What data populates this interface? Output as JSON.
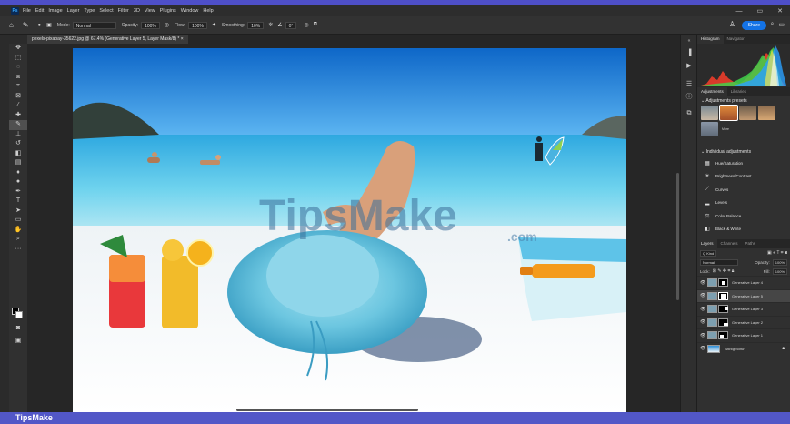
{
  "menubar": {
    "logo": "Ps",
    "items": [
      "File",
      "Edit",
      "Image",
      "Layer",
      "Type",
      "Select",
      "Filter",
      "3D",
      "View",
      "Plugins",
      "Window",
      "Help"
    ],
    "controls": [
      "—",
      "▭",
      "✕"
    ]
  },
  "options": {
    "mode_label": "Mode:",
    "mode_value": "Normal",
    "opacity_label": "Opacity:",
    "opacity_value": "100%",
    "flow_label": "Flow:",
    "flow_value": "100%",
    "smoothing_label": "Smoothing:",
    "smoothing_value": "10%",
    "angle_value": "0°",
    "share_label": "Share"
  },
  "document": {
    "tab_title": "pexels-pixabay-35622.jpg @ 67.4% (Generative Layer 5, Layer Mask/8) *  ×"
  },
  "watermark": {
    "main": "TipsMake",
    "suffix": ".com"
  },
  "panels": {
    "top_tabs": [
      "Histogram",
      "Navigator"
    ],
    "adj_tabs": [
      "Adjustments",
      "Libraries"
    ],
    "presets_title": "Adjustments presets",
    "presets_more": "More",
    "individual_title": "Individual adjustments",
    "adjustments": [
      {
        "icon": "hue-saturation-icon",
        "label": "Hue/Saturation"
      },
      {
        "icon": "brightness-contrast-icon",
        "label": "Brightness/Contrast"
      },
      {
        "icon": "curves-icon",
        "label": "Curves"
      },
      {
        "icon": "levels-icon",
        "label": "Levels"
      },
      {
        "icon": "color-balance-icon",
        "label": "Color Balance"
      },
      {
        "icon": "black-white-icon",
        "label": "Black & White"
      }
    ],
    "layer_tabs": [
      "Layers",
      "Channels",
      "Paths"
    ],
    "kind_label": "Q Kind",
    "blend_mode": "Normal",
    "opacity_label": "Opacity:",
    "opacity_value": "100%",
    "lock_label": "Lock:",
    "fill_label": "Fill:",
    "fill_value": "100%",
    "layers": [
      {
        "name": "Generative Layer 4",
        "selected": false
      },
      {
        "name": "Generative Layer 5",
        "selected": true
      },
      {
        "name": "Generative Layer 3",
        "selected": false
      },
      {
        "name": "Generative Layer 2",
        "selected": false
      },
      {
        "name": "Generative Layer 1",
        "selected": false
      },
      {
        "name": "Background",
        "selected": false
      }
    ]
  },
  "footer": {
    "brand": "TipsMake"
  }
}
